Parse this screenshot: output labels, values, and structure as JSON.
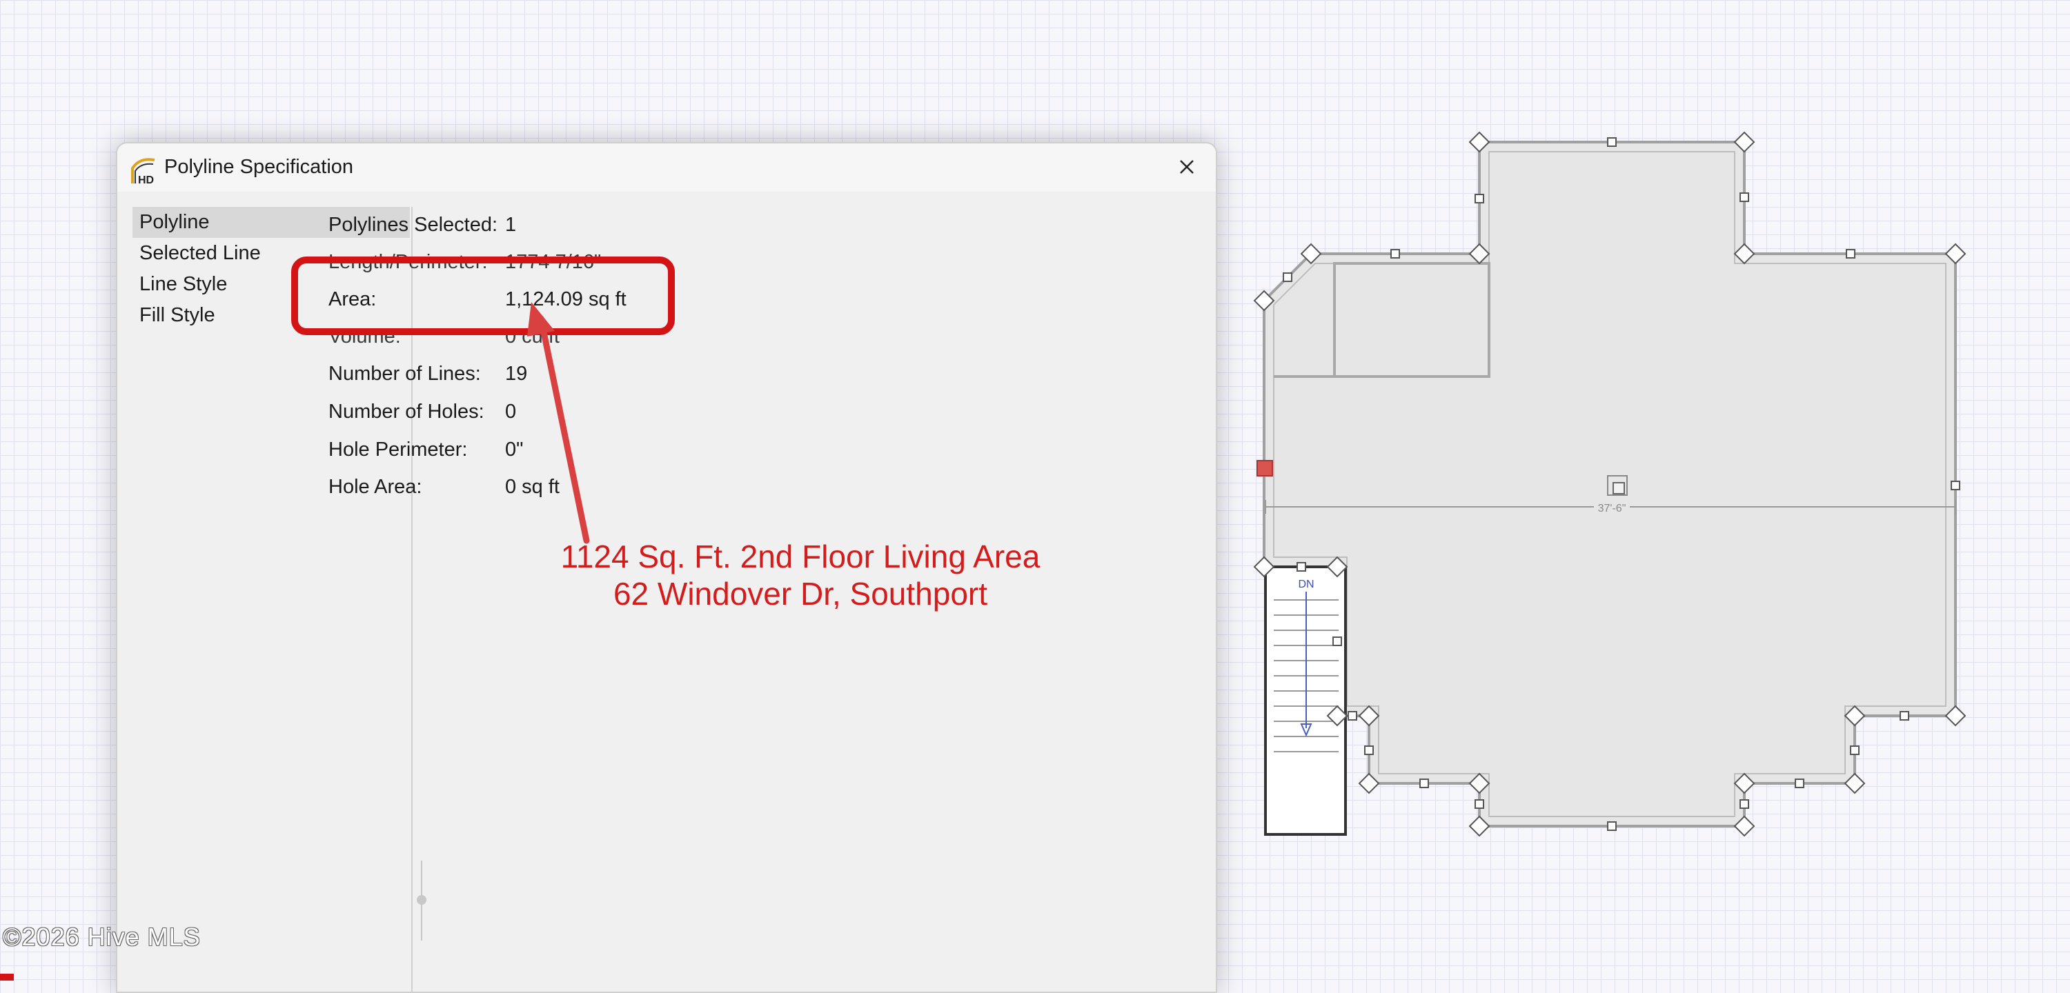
{
  "dialog": {
    "title": "Polyline Specification",
    "nav": [
      "Polyline",
      "Selected Line",
      "Line Style",
      "Fill Style"
    ],
    "properties": [
      {
        "label": "Polylines Selected:",
        "value": "1"
      },
      {
        "label": "Length/Perimeter:",
        "value": "1774 7/16\""
      },
      {
        "label": "Area:",
        "value": "1,124.09 sq ft"
      },
      {
        "label": "Volume:",
        "value": "0 cu ft"
      },
      {
        "label": "Number of Lines:",
        "value": "19"
      },
      {
        "label": "Number of Holes:",
        "value": "0"
      },
      {
        "label": "Hole Perimeter:",
        "value": "0\""
      },
      {
        "label": "Hole Area:",
        "value": "0 sq ft"
      }
    ]
  },
  "annotation": {
    "line1": "1124 Sq. Ft. 2nd Floor Living Area",
    "line2": "62 Windover Dr, Southport"
  },
  "plan": {
    "dimension_label": "37'-6\"",
    "stair_label": "DN"
  },
  "watermark": "©2026 Hive MLS",
  "colors": {
    "accent_red": "#d41414",
    "annotation_red": "#d31d1d",
    "fill_gray": "#e5e5e5",
    "wall_gray": "#9a9a9a"
  },
  "icons": {
    "app": "home-designer-icon",
    "close": "close-icon"
  }
}
